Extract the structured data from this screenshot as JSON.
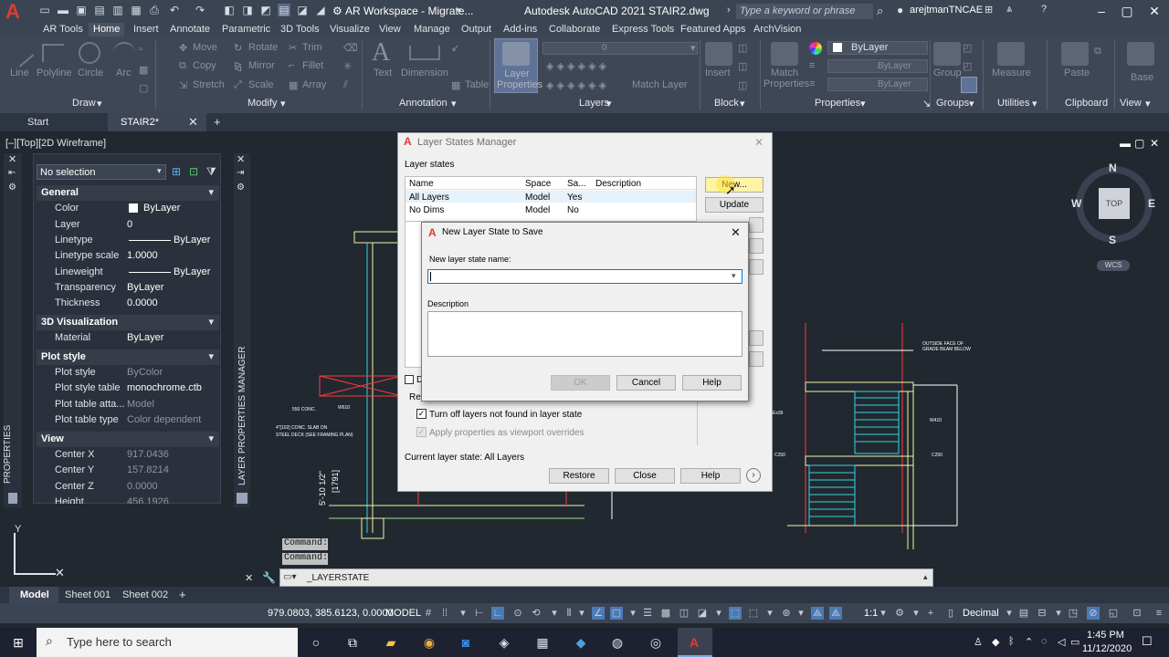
{
  "app": {
    "workspace": "AR Workspace - Migrate...",
    "title": "Autodesk AutoCAD 2021    STAIR2.dwg",
    "search_placeholder": "Type a keyword or phrase",
    "user": "arejtmanTNCAE"
  },
  "ribbon_tabs": [
    "AR Tools",
    "Home",
    "Insert",
    "Annotate",
    "Parametric",
    "3D Tools",
    "Visualize",
    "View",
    "Manage",
    "Output",
    "Add-ins",
    "Collaborate",
    "Express Tools",
    "Featured Apps",
    "ArchVision"
  ],
  "ribbon": {
    "draw": {
      "line": "Line",
      "polyline": "Polyline",
      "circle": "Circle",
      "arc": "Arc",
      "group": "Draw"
    },
    "modify": {
      "move": "Move",
      "rotate": "Rotate",
      "trim": "Trim",
      "copy": "Copy",
      "mirror": "Mirror",
      "fillet": "Fillet",
      "stretch": "Stretch",
      "scale": "Scale",
      "array": "Array",
      "group": "Modify"
    },
    "annotation": {
      "text": "Text",
      "dimension": "Dimension",
      "table": "Table",
      "group": "Annotation"
    },
    "layers": {
      "layer_properties": "Layer Properties",
      "current_layer": "0",
      "match_layer": "Match Layer",
      "group": "Layers"
    },
    "block": {
      "insert": "Insert",
      "group": "Block"
    },
    "properties": {
      "match": "Match Properties",
      "bylayer1": "ByLayer",
      "bylayer2": "ByLayer",
      "bylayer3": "ByLayer",
      "group": "Properties"
    },
    "groups": {
      "group_btn": "Group",
      "group": "Groups"
    },
    "utilities": {
      "measure": "Measure",
      "group": "Utilities"
    },
    "clipboard": {
      "paste": "Paste",
      "group": "Clipboard"
    },
    "view": {
      "base": "Base",
      "group": "View"
    }
  },
  "file_tabs": {
    "start": "Start",
    "stair": "STAIR2*"
  },
  "viewport_label": "[–][Top][2D Wireframe]",
  "palette": {
    "selection": "No selection",
    "side_label": "PROPERTIES",
    "layer_side_label": "LAYER PROPERTIES MANAGER",
    "general": "General",
    "rows_general": [
      {
        "label": "Color",
        "value": "ByLayer"
      },
      {
        "label": "Layer",
        "value": "0"
      },
      {
        "label": "Linetype",
        "value": "ByLayer"
      },
      {
        "label": "Linetype scale",
        "value": "1.0000"
      },
      {
        "label": "Lineweight",
        "value": "ByLayer"
      },
      {
        "label": "Transparency",
        "value": "ByLayer"
      },
      {
        "label": "Thickness",
        "value": "0.0000"
      }
    ],
    "viz3d": "3D Visualization",
    "material": {
      "label": "Material",
      "value": "ByLayer"
    },
    "plotstyle": "Plot style",
    "rows_plot": [
      {
        "label": "Plot style",
        "value": "ByColor"
      },
      {
        "label": "Plot style table",
        "value": "monochrome.ctb"
      },
      {
        "label": "Plot table atta...",
        "value": "Model"
      },
      {
        "label": "Plot table type",
        "value": "Color dependent"
      }
    ],
    "viewcat": "View",
    "rows_view": [
      {
        "label": "Center X",
        "value": "917.0436"
      },
      {
        "label": "Center Y",
        "value": "157.8214"
      },
      {
        "label": "Center Z",
        "value": "0.0000"
      },
      {
        "label": "Height",
        "value": "456.1926"
      }
    ]
  },
  "layer_states_manager": {
    "title": "Layer States Manager",
    "section": "Layer states",
    "columns": [
      "Name",
      "Space",
      "Sa...",
      "Description"
    ],
    "rows": [
      {
        "name": "All Layers",
        "space": "Model",
        "saved": "Yes",
        "desc": ""
      },
      {
        "name": "No Dims",
        "space": "Model",
        "saved": "No",
        "desc": ""
      }
    ],
    "new_btn": "New...",
    "update_btn": "Update",
    "turn_off_label": "Turn off layers not found in layer state",
    "apply_vp_label": "Apply properties as viewport overrides",
    "current_state": "Current layer state: All Layers",
    "restore": "Restore",
    "close": "Close",
    "help": "Help",
    "d_label": "D",
    "re_label": "Re"
  },
  "new_layer_state": {
    "title": "New Layer State to Save",
    "name_label": "New layer state name:",
    "name_value": "",
    "desc_label": "Description",
    "ok": "OK",
    "cancel": "Cancel",
    "help": "Help"
  },
  "viewcube": {
    "n": "N",
    "s": "S",
    "e": "E",
    "w": "W",
    "top": "TOP",
    "wcs": "WCS"
  },
  "drawing_text": {
    "t1": "550 CONC.",
    "t2": "W610",
    "t3": "4\"[102] CONC. SLAB ON",
    "t4": "STEEL DECK (SEE FRAMING PLAN)",
    "t5": "5'-10 1/2\"",
    "t6": "[1791]",
    "t7": "OUTSIDE FACE OF",
    "t8": "GRADE BEAM BELOW",
    "t9": "W410",
    "t10": "C250",
    "t11": "Ex39"
  },
  "command": {
    "history1": "Command:",
    "history2": "Command:",
    "input": "_LAYERSTATE"
  },
  "layout_tabs": [
    "Model",
    "Sheet 001",
    "Sheet 002"
  ],
  "status": {
    "coords": "979.0803, 385.6123, 0.0000",
    "model": "MODEL",
    "scale": "1:1",
    "units": "Decimal"
  },
  "taskbar": {
    "search": "Type here to search",
    "time": "1:45 PM",
    "date": "11/12/2020"
  }
}
